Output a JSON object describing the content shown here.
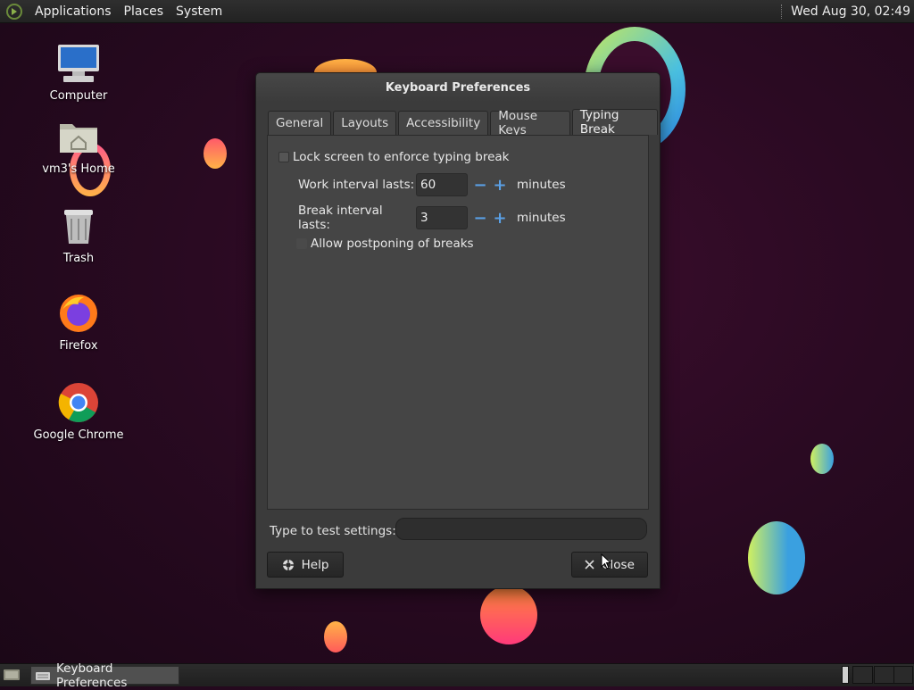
{
  "top_panel": {
    "menus": [
      "Applications",
      "Places",
      "System"
    ],
    "clock": "Wed Aug 30, 02:49"
  },
  "desktop": {
    "icons": [
      {
        "label": "Computer",
        "icon": "computer-icon"
      },
      {
        "label": "vm3's Home",
        "icon": "home-folder-icon"
      },
      {
        "label": "Trash",
        "icon": "trash-icon"
      },
      {
        "label": "Firefox",
        "icon": "firefox-icon"
      },
      {
        "label": "Google Chrome",
        "icon": "chrome-icon"
      }
    ]
  },
  "dialog": {
    "title": "Keyboard Preferences",
    "tabs": [
      "General",
      "Layouts",
      "Accessibility",
      "Mouse Keys",
      "Typing Break"
    ],
    "active_tab": "Typing Break",
    "lock_screen_label": "Lock screen to enforce typing break",
    "work_label": "Work interval lasts:",
    "work_value": "60",
    "break_label": "Break interval lasts:",
    "break_value": "3",
    "minutes_label": "minutes",
    "spin_minus": "−",
    "spin_plus": "+",
    "postpone_label": "Allow postponing of breaks",
    "test_label": "Type to test settings:",
    "help_button": "Help",
    "close_button": "Close"
  },
  "bottom_panel": {
    "task_label": "Keyboard Preferences"
  },
  "colors": {
    "accent": "#5aa0e6",
    "desktop_bg": "#2a0a22",
    "dialog_bg": "#3b3b3b"
  }
}
